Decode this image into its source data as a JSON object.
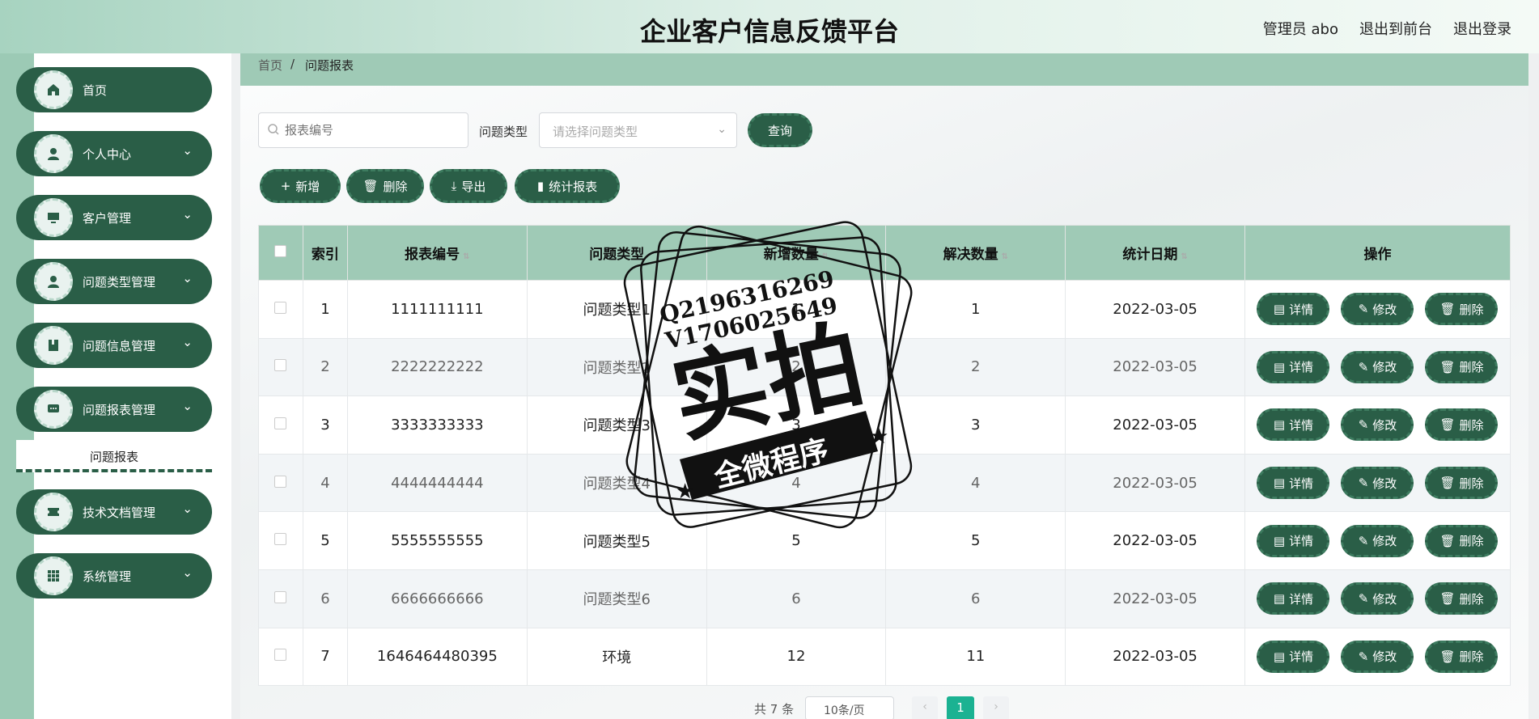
{
  "header": {
    "title": "企业客户信息反馈平台",
    "user_label": "管理员 abo",
    "to_front_label": "退出到前台",
    "logout_label": "退出登录"
  },
  "sidebar": {
    "items": [
      {
        "label": "首页",
        "icon": "home-icon"
      },
      {
        "label": "个人中心",
        "icon": "user-icon"
      },
      {
        "label": "客户管理",
        "icon": "monitor-icon"
      },
      {
        "label": "问题类型管理",
        "icon": "user-icon"
      },
      {
        "label": "问题信息管理",
        "icon": "book-icon"
      },
      {
        "label": "问题报表管理",
        "icon": "chat-icon"
      },
      {
        "label": "技术文档管理",
        "icon": "ticket-icon"
      },
      {
        "label": "系统管理",
        "icon": "grid-icon"
      }
    ],
    "submenu_active": "问题报表"
  },
  "breadcrumb": {
    "home": "首页",
    "separator": "/",
    "current": "问题报表"
  },
  "search": {
    "placeholder": "报表编号",
    "type_label": "问题类型",
    "type_placeholder": "请选择问题类型",
    "query_label": "查询"
  },
  "toolbar": {
    "add_label": "新增",
    "delete_label": "删除",
    "export_label": "导出",
    "stats_label": "统计报表"
  },
  "table": {
    "headers": [
      "索引",
      "报表编号",
      "问题类型",
      "新增数量",
      "解决数量",
      "统计日期",
      "操作"
    ],
    "rows": [
      {
        "index": "1",
        "code": "1111111111",
        "type": "问题类型1",
        "added": "1",
        "solved": "1",
        "date": "2022-03-05"
      },
      {
        "index": "2",
        "code": "2222222222",
        "type": "问题类型2",
        "added": "2",
        "solved": "2",
        "date": "2022-03-05"
      },
      {
        "index": "3",
        "code": "3333333333",
        "type": "问题类型3",
        "added": "3",
        "solved": "3",
        "date": "2022-03-05"
      },
      {
        "index": "4",
        "code": "4444444444",
        "type": "问题类型4",
        "added": "4",
        "solved": "4",
        "date": "2022-03-05"
      },
      {
        "index": "5",
        "code": "5555555555",
        "type": "问题类型5",
        "added": "5",
        "solved": "5",
        "date": "2022-03-05"
      },
      {
        "index": "6",
        "code": "6666666666",
        "type": "问题类型6",
        "added": "6",
        "solved": "6",
        "date": "2022-03-05"
      },
      {
        "index": "7",
        "code": "1646464480395",
        "type": "环境",
        "added": "12",
        "solved": "11",
        "date": "2022-03-05"
      }
    ],
    "row_actions": {
      "detail": "详情",
      "edit": "修改",
      "delete": "删除"
    }
  },
  "pagination": {
    "total": "共 7 条",
    "page_size": "10条/页",
    "current_page": "1",
    "prev": "‹",
    "next": "›"
  },
  "watermark": {
    "line1": "Q2196316269",
    "line2": "V1706025649",
    "big": "实拍",
    "ribbon": "全微程序"
  },
  "colors": {
    "primary": "#2a5e47",
    "accent": "#9fcab6",
    "page_active": "#1bb292"
  }
}
